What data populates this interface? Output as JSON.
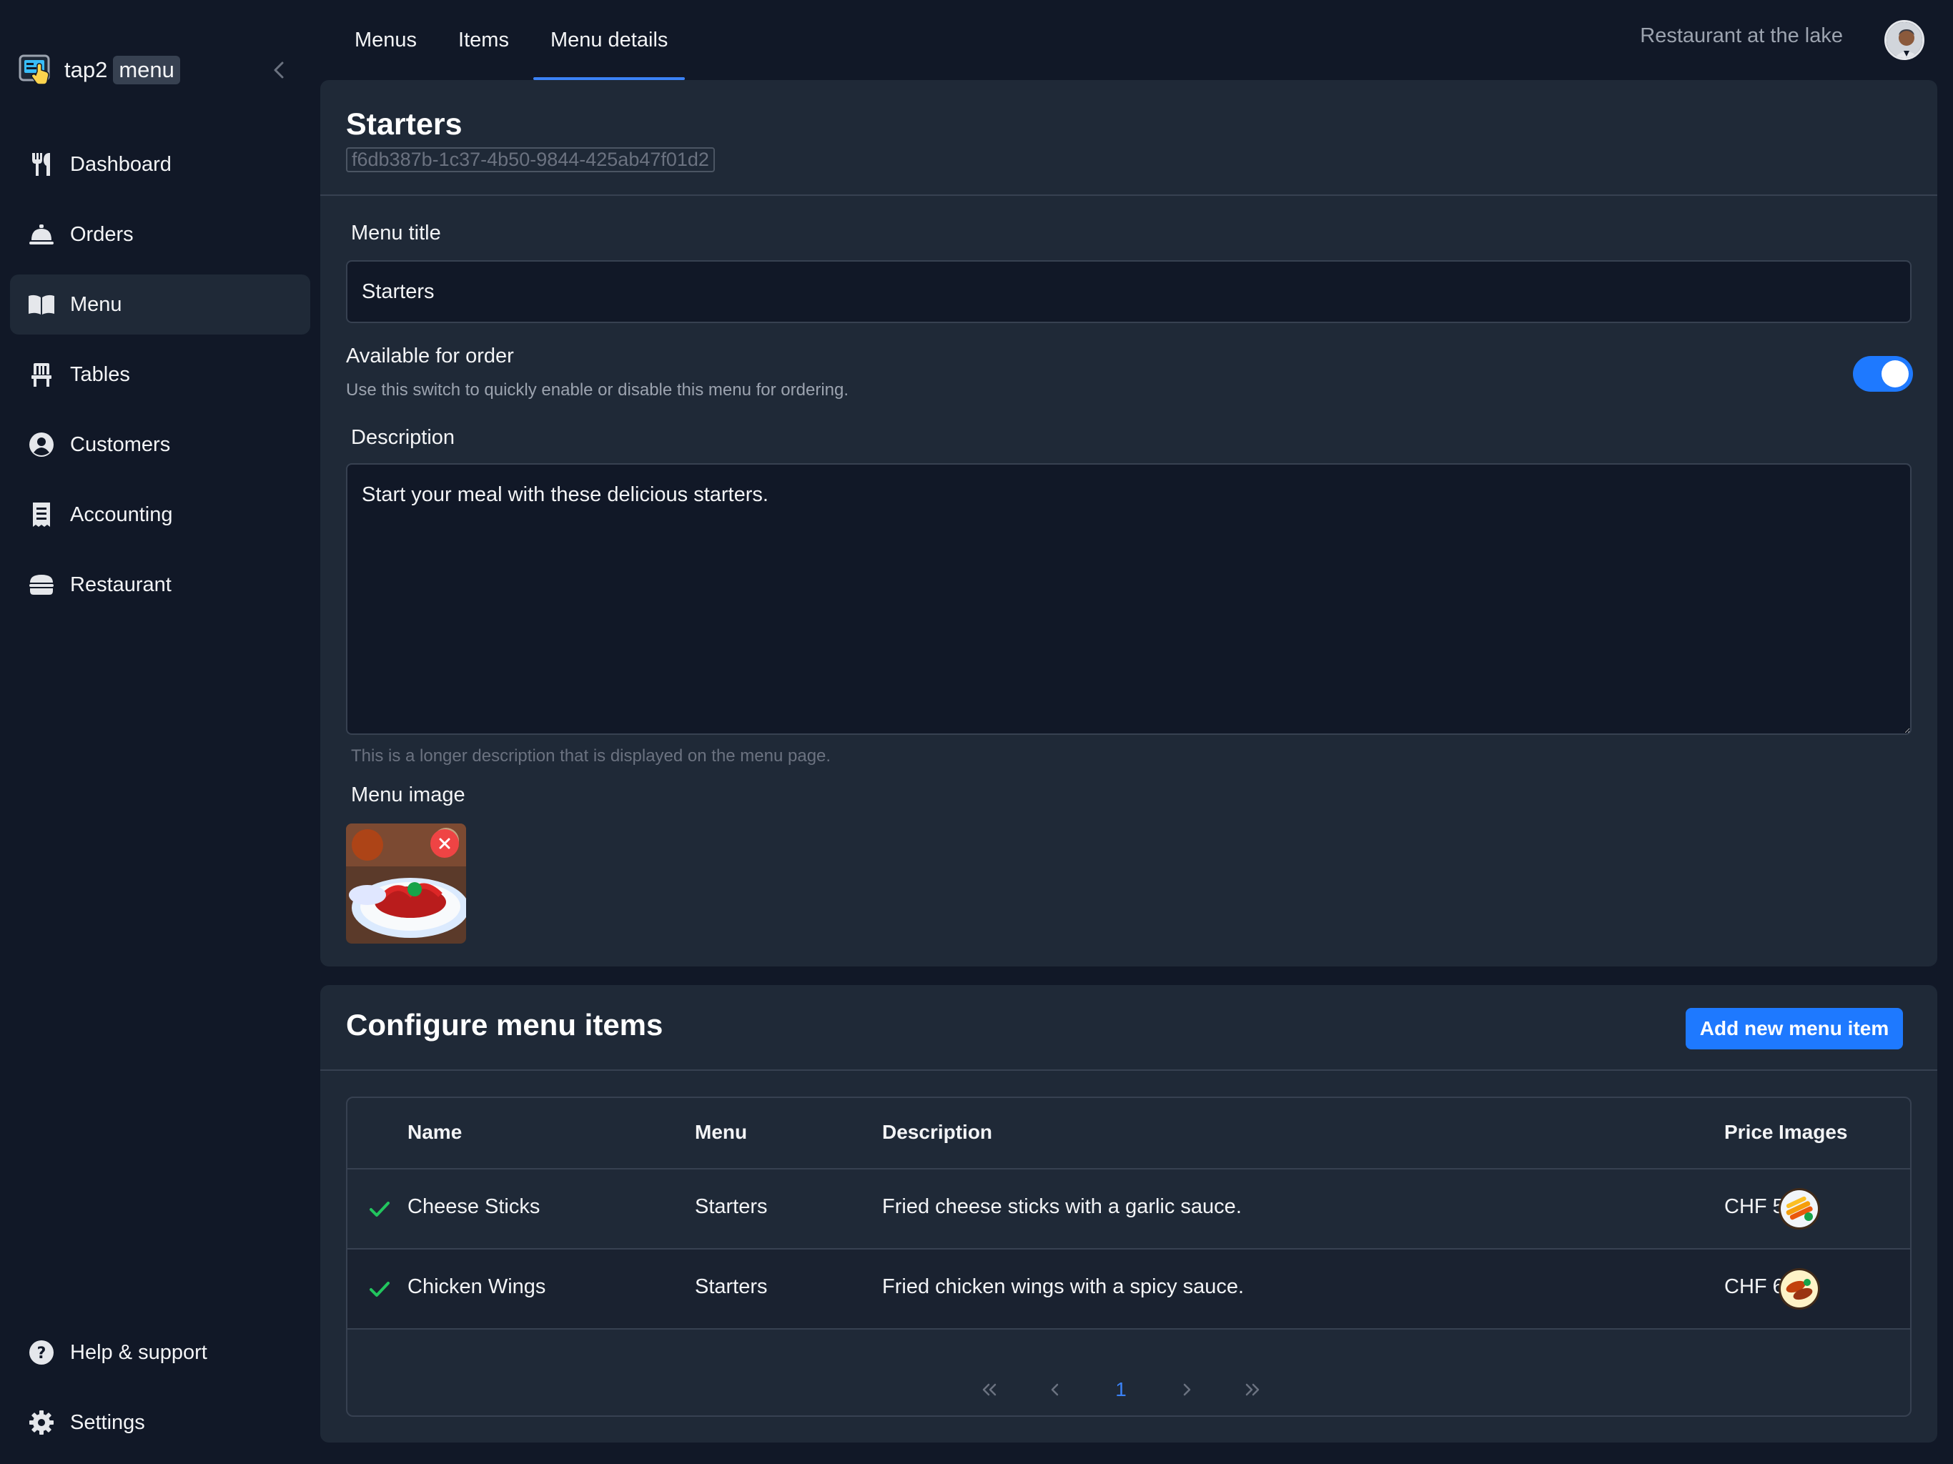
{
  "app": {
    "logo_text": "tap2",
    "logo_chip": "menu"
  },
  "sidebar": {
    "items": [
      {
        "label": "Dashboard",
        "icon": "utensils-icon",
        "active": false
      },
      {
        "label": "Orders",
        "icon": "service-bell-icon",
        "active": false
      },
      {
        "label": "Menu",
        "icon": "book-open-icon",
        "active": true
      },
      {
        "label": "Tables",
        "icon": "chair-icon",
        "active": false
      },
      {
        "label": "Customers",
        "icon": "user-circle-icon",
        "active": false
      },
      {
        "label": "Accounting",
        "icon": "receipt-icon",
        "active": false
      },
      {
        "label": "Restaurant",
        "icon": "burger-icon",
        "active": false
      }
    ],
    "bottom": [
      {
        "label": "Help & support",
        "icon": "question-circle-icon"
      },
      {
        "label": "Settings",
        "icon": "gear-icon"
      }
    ]
  },
  "header": {
    "tabs": [
      {
        "label": "Menus",
        "active": false
      },
      {
        "label": "Items",
        "active": false
      },
      {
        "label": "Menu details",
        "active": true
      }
    ],
    "restaurant_name": "Restaurant at the lake"
  },
  "menu": {
    "title": "Starters",
    "id": "f6db387b-1c37-4b50-9844-425ab47f01d2",
    "title_label": "Menu title",
    "title_value": "Starters",
    "available_label": "Available for order",
    "available_hint": "Use this switch to quickly enable or disable this menu for ordering.",
    "available": true,
    "description_label": "Description",
    "description_value": "Start your meal with these delicious starters.",
    "description_hint": "This is a longer description that is displayed on the menu page.",
    "image_label": "Menu image"
  },
  "items_section": {
    "title": "Configure menu items",
    "add_button": "Add new menu item",
    "columns": [
      "Name",
      "Menu",
      "Description",
      "Price",
      "Images"
    ],
    "rows": [
      {
        "name": "Cheese Sticks",
        "menu": "Starters",
        "description": "Fried cheese sticks with a garlic sauce.",
        "price": "CHF 5.00"
      },
      {
        "name": "Chicken Wings",
        "menu": "Starters",
        "description": "Fried chicken wings with a spicy sauce.",
        "price": "CHF 6.00"
      }
    ],
    "pagination": {
      "first": "«",
      "prev": "‹",
      "current": "1",
      "next": "›",
      "last": "»"
    }
  },
  "colors": {
    "accent": "#1e79ff",
    "background": "#111827",
    "panel": "#1f2937",
    "success": "#22c55e",
    "danger": "#ef4444"
  }
}
